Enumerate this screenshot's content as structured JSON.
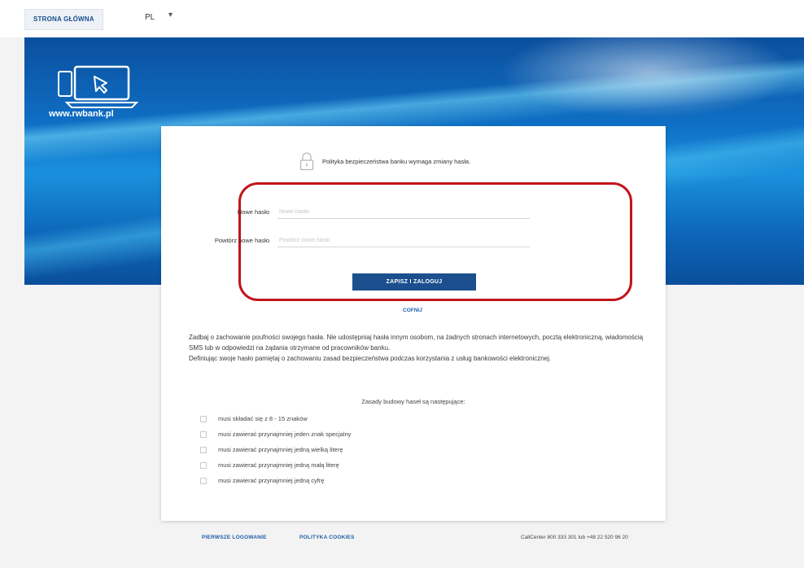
{
  "header": {
    "home_button": "STRONA GŁÓWNA",
    "language": "PL"
  },
  "hero": {
    "site_url": "www.rwbank.pl"
  },
  "card": {
    "policy_message": "Polityka bezpieczeństwa banku wymaga zmiany hasła.",
    "new_password_label": "Nowe hasło",
    "new_password_placeholder": "Nowe hasło",
    "repeat_password_label": "Powtórz nowe hasło",
    "repeat_password_placeholder": "Powtórz nowe hasło",
    "save_button": "ZAPISZ I ZALOGUJ",
    "back_link": "COFNIJ",
    "info_paragraph_1": "Zadbaj o zachowanie poufności swojego hasła. Nie udostępniaj hasła innym osobom, na żadnych stronach internetowych, pocztą elektroniczną, wiadomością SMS lub w odpowiedzi na żądania otrzymane od pracowników banku.",
    "info_paragraph_2": "Definiując swoje hasło pamiętaj o zachowaniu zasad bezpieczeństwa podczas korzystania z usług bankowości elektronicznej.",
    "rules_heading": "Zasady budowy haseł są następujące:",
    "rules": [
      "musi składać się z 8 - 15 znaków",
      "musi zawierać przynajmniej jeden znak specjalny",
      "musi zawierać przynajmniej jedną wielką literę",
      "musi zawierać przynajmniej jedną małą literę",
      "musi zawierać przynajmniej jedną cyfrę"
    ]
  },
  "footer": {
    "first_login_link": "PIERWSZE LOGOWANIE",
    "privacy_link": "POLITYKA COOKIES",
    "callcenter": "CallCenter 800 333 301 lub +48 22 520 96 20"
  },
  "colors": {
    "primary": "#1b4f8e",
    "highlight": "#c2141b",
    "hero_blue": "#0f6fc4"
  },
  "icons": {
    "logo": "device-laptop-icon",
    "lock": "lock-icon",
    "dropdown": "chevron-down-icon"
  }
}
